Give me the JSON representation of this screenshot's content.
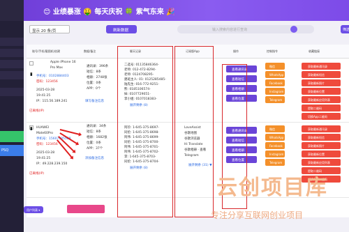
{
  "header": {
    "title": "😊 业绩暴涨 🤑 每天庆祝 🍀 紫气东来 🎉"
  },
  "sidebar": {
    "blue_label": "PSQ"
  },
  "toolbar": {
    "page_size": "显示 20 条/页",
    "refresh_label": "刷新数据",
    "search_placeholder": "输入搜索内容进行查询",
    "filter_label": "筛选"
  },
  "table": {
    "headers": [
      "账号/手机/截图机/创建",
      "数据/备注",
      "聊天记录",
      "订阅版App",
      "操作",
      "控制指令",
      "收藏链接"
    ],
    "rows": [
      {
        "device": "Apple iPhone 16 Pro Max",
        "phone": "手机号：0102884403",
        "pwd": "密码：123456",
        "date": "2025-03-28",
        "time": "19:41:25",
        "ip": "IP：115.56.189.241",
        "status": "已离线(IP)",
        "stats": [
          "通讯录：396条",
          "短信：8条",
          "相册：2748张",
          "位置：0条",
          "APP：0个"
        ],
        "remark": "填写备注信息",
        "chat": [
          "二选号: 01135846364-",
          "老师: 012-472-8294-",
          "老师: 0124708295-",
          "建班主人: 01: 0125285485-",
          "陆先生: 016-772-9251-",
          "熊: 0185106574-",
          "妹: 0107729051-",
          "李小姐: 0107018383-"
        ],
        "chat_more": "展开剩余 (8)",
        "apps": [],
        "actions": [
          "查看通讯录",
          "查看短信",
          "查看相册",
          "查看位置"
        ],
        "controls": [
          "微信",
          "WhatsApp",
          "Facebook",
          "Instagram",
          "Telegram"
        ],
        "links": [
          "获取最新通讯录",
          "获取最新短信",
          "获取最新照片",
          "获取最新位置",
          "获取最新应用列表",
          "提取二维码",
          "切换App二维码"
        ]
      },
      {
        "device": "HUAWEI Mate60Pro",
        "phone": "手机号：15607985588",
        "pwd": "密码：123456",
        "date": "2025-03-28",
        "time": "19:41:25",
        "ip": "IP：49.228.239.150",
        "status": "已离线(IP)",
        "stats": [
          "通讯录：34条",
          "短信：8条",
          "相册：1682张",
          "位置：0条",
          "APP：37个"
        ],
        "remark": "添加备注信息",
        "chat": [
          "阿珍: 1-645-375-8697-",
          "同伦: 1-645-375-8698-",
          "阿伟: 1-645-375-8699-",
          "同伦: 1-645-375-8700-",
          "阿伟: 1-645-375-8701-",
          "阿伟: 1-645-375-8702-",
          "李: 1-645-375-8703-",
          "同伦: 1-645-375-8704-"
        ],
        "chat_more": "展开剩余 (8)",
        "apps": [
          "LoveAssist",
          "谷歌地图",
          "谷歌浏览器",
          "Hi Translate",
          "谷歌相册 · 查看",
          "Telegram"
        ],
        "apps_more": "展开剩余 (31) ▼",
        "actions": [
          "查看通讯录",
          "查看短信",
          "查看相册",
          "查看位置"
        ],
        "controls": [
          "微信",
          "WhatsApp",
          "Facebook",
          "Instagram",
          "Telegram"
        ],
        "links": [
          "获取最新通讯录",
          "获取最新短信",
          "获取最新照片",
          "获取最新位置",
          "获取最新应用列表",
          "提取二维码",
          "切换App二维码"
        ]
      }
    ],
    "checkbox_label": "✓"
  },
  "footer": {
    "users_label": "用户列表 ▾"
  },
  "watermark": {
    "big": "云创项目库",
    "small": "专注分享互联网创业项目"
  }
}
